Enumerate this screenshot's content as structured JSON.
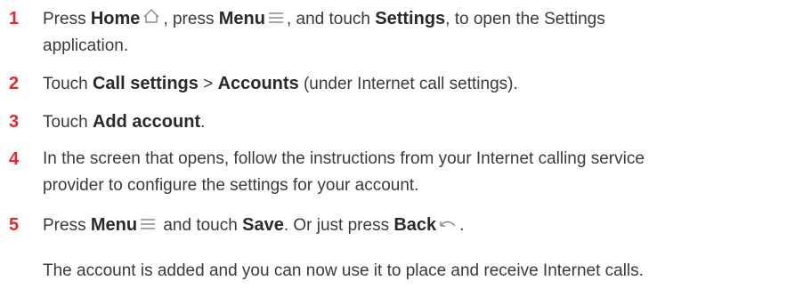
{
  "steps": [
    {
      "number": "1",
      "parts": {
        "a": "Press ",
        "b": "Home",
        "c": ", press ",
        "d": "Menu",
        "e": ", and touch ",
        "f": "Settings",
        "g": ", to open the Settings",
        "h": "application."
      }
    },
    {
      "number": "2",
      "parts": {
        "a": "Touch ",
        "b": "Call settings",
        "c": " > ",
        "d": "Accounts",
        "e": " (under Internet call settings)."
      }
    },
    {
      "number": "3",
      "parts": {
        "a": "Touch ",
        "b": "Add account",
        "c": "."
      }
    },
    {
      "number": "4",
      "parts": {
        "a": "In the screen that opens, follow the instructions from your Internet calling service",
        "b": "provider to configure the settings for your account."
      }
    },
    {
      "number": "5",
      "parts": {
        "a": "Press ",
        "b": "Menu",
        "c": " and touch ",
        "d": "Save",
        "e": ". Or just press ",
        "f": "Back",
        "g": "."
      }
    }
  ],
  "note": "The account is added and you can now use it to place and receive Internet calls.",
  "icons": {
    "home": "home-icon",
    "menu": "menu-icon",
    "back": "back-icon"
  },
  "colors": {
    "step_number": "#e8262b",
    "text": "#3a3a3a"
  }
}
